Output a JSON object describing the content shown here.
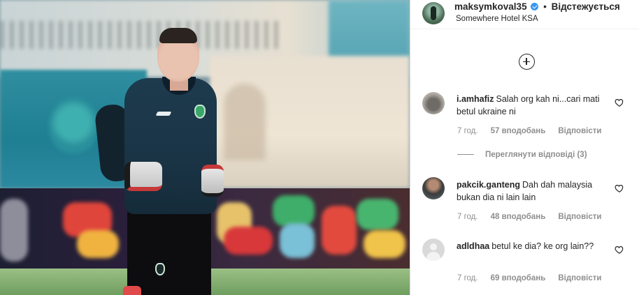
{
  "post": {
    "username": "maksymkoval35",
    "separator": "•",
    "follow_label": "Відстежується",
    "location": "Somewhere Hotel KSA"
  },
  "comments": [
    {
      "username": "i.amhafiz",
      "text": "Salah org kah ni...cari mati betul ukraine ni",
      "time": "7 год.",
      "likes": "57 вподобань",
      "reply_label": "Відповісти",
      "view_replies": "Переглянути відповіді (3)"
    },
    {
      "username": "pakcik.ganteng",
      "text": "Dah dah malaysia bukan dia ni lain lain",
      "time": "7 год.",
      "likes": "48 вподобань",
      "reply_label": "Відповісти"
    },
    {
      "username": "adldhaa",
      "text": "betul ke dia? ke org lain??",
      "time": "7 год.",
      "likes": "69 вподобань",
      "reply_label": "Відповісти"
    }
  ],
  "icons": {
    "verified": "verified-badge-icon",
    "add": "plus-circle-icon",
    "heart": "heart-outline-icon"
  },
  "colors": {
    "verified": "#3897f0",
    "meta_text": "#8e8e8e",
    "primary_text": "#262626"
  }
}
